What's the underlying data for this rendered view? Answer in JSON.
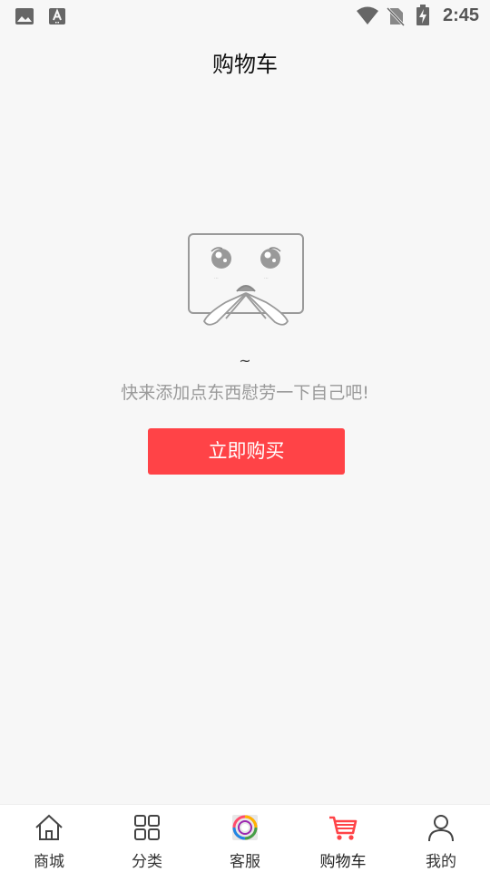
{
  "status_bar": {
    "time": "2:45",
    "left_icons": [
      "image-icon",
      "a-download-icon"
    ],
    "right_icons": [
      "wifi-icon",
      "no-sim-icon",
      "battery-charging-icon"
    ]
  },
  "header": {
    "title": "购物车"
  },
  "empty_state": {
    "illustration": "sad-box-icon",
    "tilde": "~",
    "message": "快来添加点东西慰劳一下自己吧!",
    "button_label": "立即购买"
  },
  "tab_bar": {
    "active_tab": 3,
    "active_color": "#ff4347",
    "tabs": [
      {
        "label": "商城",
        "icon": "home-icon"
      },
      {
        "label": "分类",
        "icon": "grid-icon"
      },
      {
        "label": "客服",
        "icon": "customer-service-icon"
      },
      {
        "label": "购物车",
        "icon": "cart-icon"
      },
      {
        "label": "我的",
        "icon": "user-icon"
      }
    ]
  },
  "colors": {
    "background": "#f7f7f7",
    "accent": "#ff4347",
    "muted_text": "#9a9a9a"
  }
}
